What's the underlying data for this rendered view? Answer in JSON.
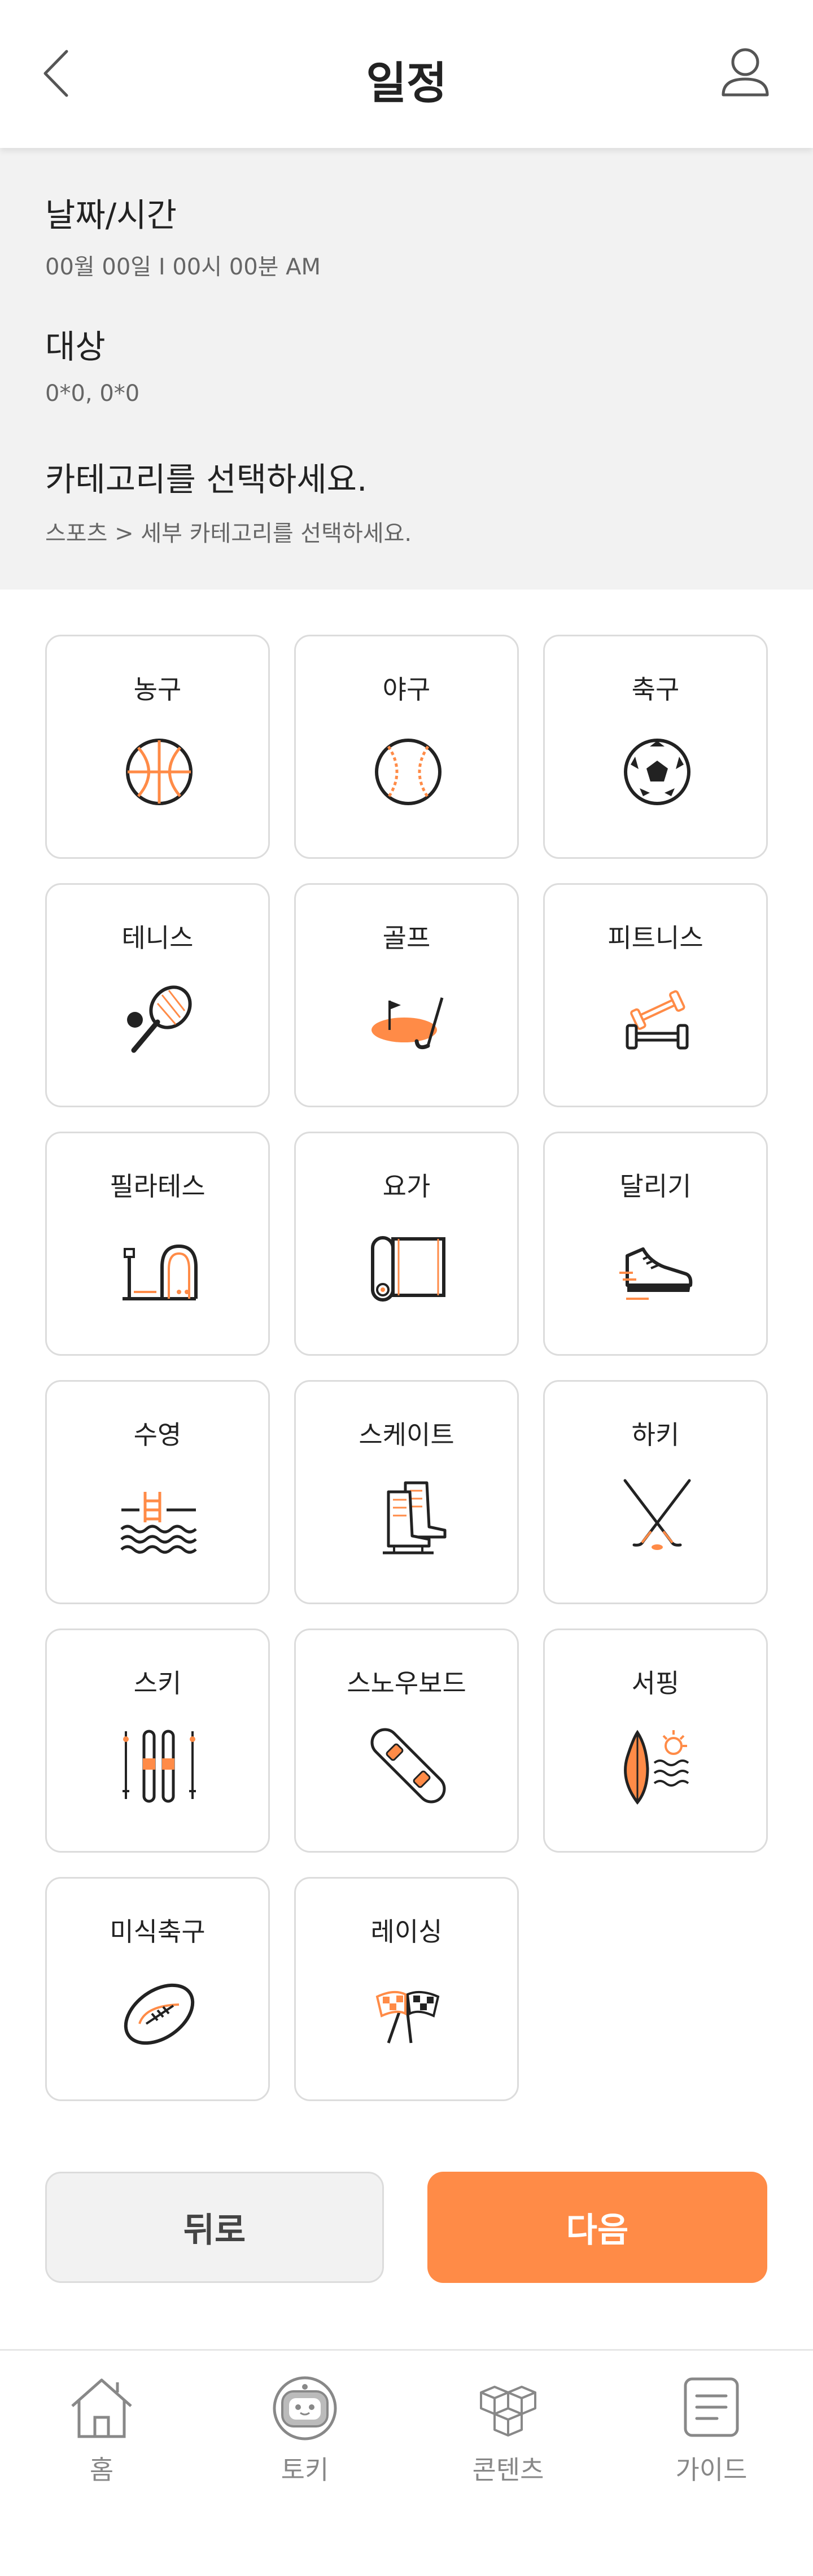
{
  "header": {
    "title": "일정"
  },
  "info": {
    "datetime_label": "날짜/시간",
    "datetime_value": "00월 00일  I  00시 00분  AM",
    "target_label": "대상",
    "target_value": "0*0, 0*0",
    "category_label": "카테고리를 선택하세요.",
    "category_path": "스포츠 > 세부 카테고리를 선택하세요."
  },
  "categories": [
    {
      "label": "농구",
      "icon": "basketball-icon"
    },
    {
      "label": "야구",
      "icon": "baseball-icon"
    },
    {
      "label": "축구",
      "icon": "soccer-ball-icon"
    },
    {
      "label": "테니스",
      "icon": "tennis-icon"
    },
    {
      "label": "골프",
      "icon": "golf-icon"
    },
    {
      "label": "피트니스",
      "icon": "dumbbell-icon"
    },
    {
      "label": "필라테스",
      "icon": "pilates-reformer-icon"
    },
    {
      "label": "요가",
      "icon": "yoga-mat-icon"
    },
    {
      "label": "달리기",
      "icon": "running-shoe-icon"
    },
    {
      "label": "수영",
      "icon": "swimming-pool-icon"
    },
    {
      "label": "스케이트",
      "icon": "ice-skate-icon"
    },
    {
      "label": "하키",
      "icon": "hockey-sticks-icon"
    },
    {
      "label": "스키",
      "icon": "skis-icon"
    },
    {
      "label": "스노우보드",
      "icon": "snowboard-icon"
    },
    {
      "label": "서핑",
      "icon": "surfboard-icon"
    },
    {
      "label": "미식축구",
      "icon": "american-football-icon"
    },
    {
      "label": "레이싱",
      "icon": "racing-flags-icon"
    }
  ],
  "buttons": {
    "back": "뒤로",
    "next": "다음"
  },
  "nav": [
    {
      "label": "홈",
      "icon": "home-icon"
    },
    {
      "label": "토키",
      "icon": "robot-icon"
    },
    {
      "label": "콘텐츠",
      "icon": "boxes-icon"
    },
    {
      "label": "가이드",
      "icon": "document-icon"
    }
  ],
  "colors": {
    "accent": "#ff8b47",
    "panel": "#f2f2f2",
    "border": "#dcdcdc",
    "text": "#222222"
  }
}
